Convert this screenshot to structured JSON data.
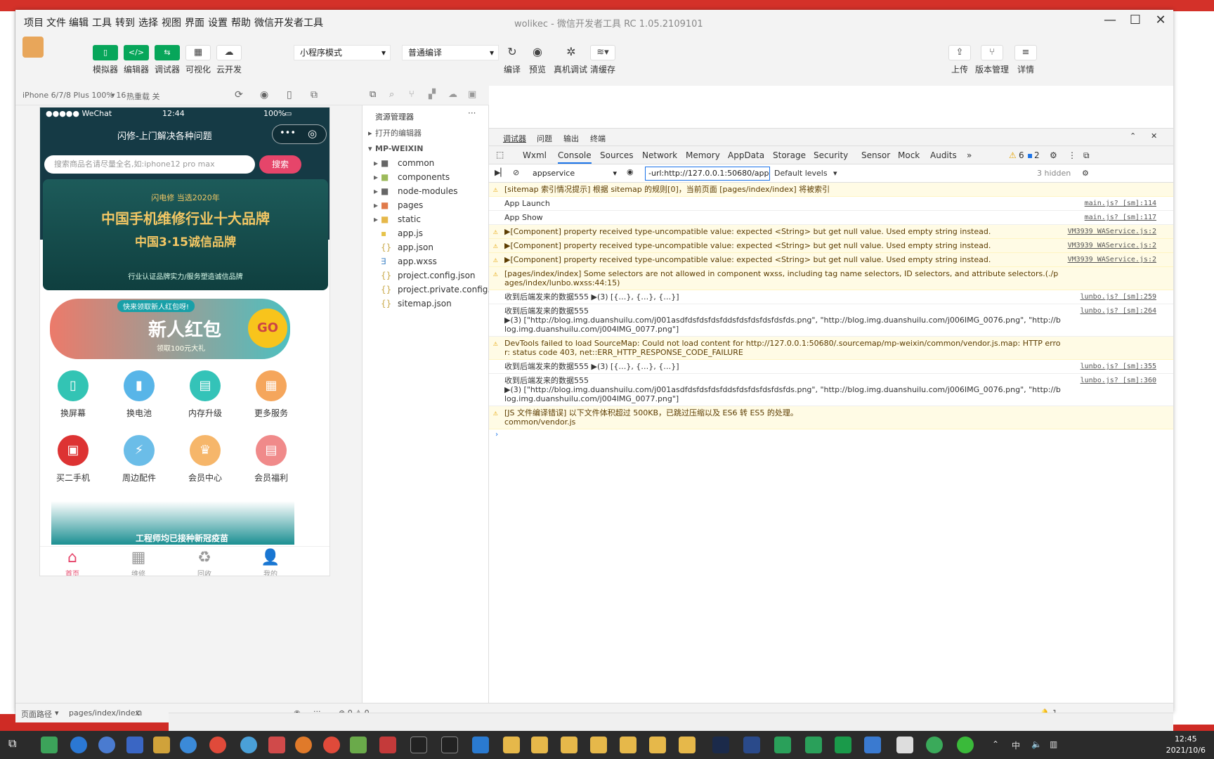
{
  "window": {
    "title": "wolikec - 微信开发者工具 RC 1.05.2109101",
    "menu": [
      "项目",
      "文件",
      "编辑",
      "工具",
      "转到",
      "选择",
      "视图",
      "界面",
      "设置",
      "帮助",
      "微信开发者工具"
    ]
  },
  "toolbar": {
    "mode_buttons": [
      "模拟器",
      "编辑器",
      "调试器",
      "可视化",
      "云开发"
    ],
    "mode_select": "小程序模式",
    "compile_select": "普通编译",
    "actions": [
      "编译",
      "预览",
      "真机调试",
      "清缓存"
    ],
    "right_actions": [
      "上传",
      "版本管理",
      "详情"
    ]
  },
  "simulator": {
    "device": "iPhone 6/7/8 Plus 100% 16",
    "hot_reload": "热重载 关",
    "status_left": "●●●●● WeChat",
    "status_time": "12:44",
    "status_battery": "100%",
    "page_title": "闪修-上门解决各种问题",
    "search_placeholder": "搜索商品名请尽量全名,如:iphone12 pro max",
    "search_button": "搜索",
    "banner_top": "闪电修 当选2020年",
    "banner_line1": "中国手机维修行业十大品牌",
    "banner_line2": "中国3·15诚信品牌",
    "banner_bottom": "行业认证品牌实力/服务塑造诚信品牌",
    "redpacket_tag": "快来领取新人红包呀!",
    "redpacket_title": "新人红包",
    "redpacket_sub": "领取100元大礼",
    "redpacket_go": "GO",
    "grid": [
      "换屏幕",
      "换电池",
      "内存升级",
      "更多服务",
      "买二手机",
      "周边配件",
      "会员中心",
      "会员福利"
    ],
    "promo_text": "工程师均已接种新冠疫苗",
    "tabs": [
      "首页",
      "维修",
      "回收",
      "我的"
    ]
  },
  "explorer": {
    "header": "资源管理器",
    "open_editors": "打开的编辑器",
    "project": "MP-WEIXIN",
    "items": [
      "common",
      "components",
      "node-modules",
      "pages",
      "static",
      "app.js",
      "app.json",
      "app.wxss",
      "project.config.json",
      "project.private.config.js...",
      "sitemap.json"
    ]
  },
  "devtools": {
    "top_tabs": [
      "调试器",
      "问题",
      "输出",
      "终端"
    ],
    "tabs": [
      "Wxml",
      "Console",
      "Sources",
      "Network",
      "Memory",
      "AppData",
      "Storage",
      "Security",
      "Sensor",
      "Mock",
      "Audits"
    ],
    "warn_count": "6",
    "info_count": "2",
    "context": "appservice",
    "filter_value": "-url:http://127.0.0.1:50680/appser",
    "levels": "Default levels",
    "hidden": "3 hidden",
    "logs": [
      {
        "type": "warn",
        "text": "[sitemap 索引情况提示] 根据 sitemap 的规则[0]，当前页面 [pages/index/index] 将被索引",
        "src": ""
      },
      {
        "type": "log",
        "text": "App Launch",
        "src": "main.js? [sm]:114"
      },
      {
        "type": "log",
        "text": "App Show",
        "src": "main.js? [sm]:117"
      },
      {
        "type": "warn",
        "text": "▶[Component] property received type-uncompatible value: expected <String> but get null value. Used empty string instead.",
        "src": "VM3939 WAService.js:2"
      },
      {
        "type": "warn",
        "text": "▶[Component] property received type-uncompatible value: expected <String> but get null value. Used empty string instead.",
        "src": "VM3939 WAService.js:2"
      },
      {
        "type": "warn",
        "text": "▶[Component] property received type-uncompatible value: expected <String> but get null value. Used empty string instead.",
        "src": "VM3939 WAService.js:2"
      },
      {
        "type": "warn",
        "text": "[pages/index/index] Some selectors are not allowed in component wxss, including tag name selectors, ID selectors, and attribute selectors.(./pages/index/lunbo.wxss:44:15)",
        "src": ""
      },
      {
        "type": "log",
        "text": "收到后端发来的数据555 ▶(3) [{…}, {…}, {…}]",
        "src": "lunbo.js? [sm]:259"
      },
      {
        "type": "log",
        "text": "收到后端发来的数据555\n▶(3) [\"http://blog.img.duanshuilu.com/j001asdfdsfdsfdsfddsfdsfdsfdsfdsfds.png\", \"http://blog.img.duanshuilu.com/j006IMG_0076.png\", \"http://blog.img.duanshuilu.com/j004IMG_0077.png\"]",
        "src": "lunbo.js? [sm]:264"
      },
      {
        "type": "warn",
        "text": "DevTools failed to load SourceMap: Could not load content for http://127.0.0.1:50680/.sourcemap/mp-weixin/common/vendor.js.map: HTTP error: status code 403, net::ERR_HTTP_RESPONSE_CODE_FAILURE",
        "src": ""
      },
      {
        "type": "log",
        "text": "收到后端发来的数据555 ▶(3) [{…}, {…}, {…}]",
        "src": "lunbo.js? [sm]:355"
      },
      {
        "type": "log",
        "text": "收到后端发来的数据555\n▶(3) [\"http://blog.img.duanshuilu.com/j001asdfdsfdsfdsfddsfdsfdsfdsfdsfds.png\", \"http://blog.img.duanshuilu.com/j006IMG_0076.png\", \"http://blog.img.duanshuilu.com/j004IMG_0077.png\"]",
        "src": "lunbo.js? [sm]:360"
      },
      {
        "type": "warn",
        "text": "[JS 文件编译错误] 以下文件体积超过 500KB，已跳过压缩以及 ES6 转 ES5 的处理。\ncommon/vendor.js",
        "src": ""
      }
    ]
  },
  "bottom": {
    "path_label": "页面路径",
    "path": "pages/index/index",
    "errors": "⊗ 0 ⚠ 0",
    "notifications": "1"
  },
  "taskbar": {
    "time": "12:45",
    "date": "2021/10/6"
  },
  "colors": {
    "accent_green": "#07a65a",
    "warn_bg": "#fffbe5",
    "phone_header": "#153a45"
  }
}
